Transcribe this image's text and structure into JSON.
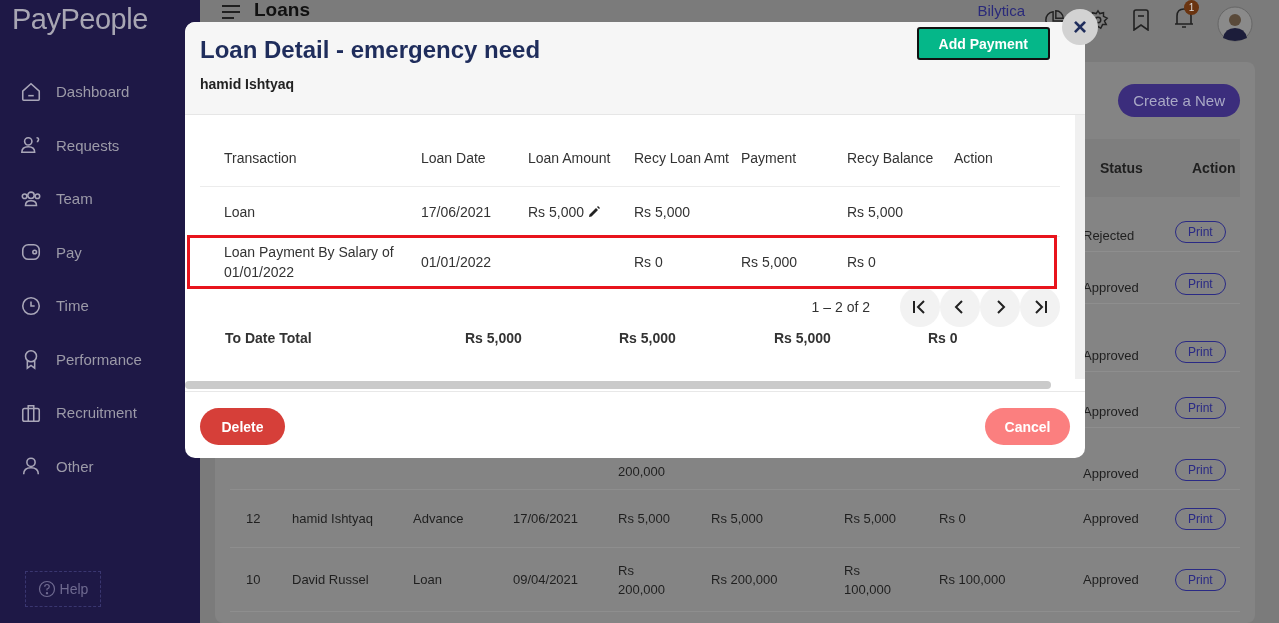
{
  "sidebar": {
    "logo": "PayPeople",
    "items": [
      {
        "label": "Dashboard"
      },
      {
        "label": "Requests"
      },
      {
        "label": "Team"
      },
      {
        "label": "Pay"
      },
      {
        "label": "Time"
      },
      {
        "label": "Performance"
      },
      {
        "label": "Recruitment"
      },
      {
        "label": "Other"
      }
    ],
    "help": "Help"
  },
  "header": {
    "title": "Loans",
    "company": "Bilytica",
    "notification_count": "1"
  },
  "page": {
    "create_button": "Create a New",
    "table": {
      "columns": [
        "Status",
        "Action"
      ],
      "rows": [
        {
          "status": "Rejected",
          "action": "Print"
        },
        {
          "status": "Approved",
          "action": "Print"
        },
        {
          "status": "Approved",
          "action": "Print"
        },
        {
          "status": "Approved",
          "action": "Print"
        },
        {
          "column_5": "200,000",
          "status": "Approved",
          "action": "Print"
        },
        {
          "column_1": "12",
          "column_2": "hamid Ishtyaq",
          "column_3": "Advance",
          "column_4": "17/06/2021",
          "column_5": "Rs 5,000",
          "column_6": "Rs 5,000",
          "column_7": "Rs 5,000",
          "column_8": "Rs 0",
          "status": "Approved",
          "action": "Print"
        },
        {
          "column_1": "10",
          "column_2": "David Russel",
          "column_3": "Loan",
          "column_4": "09/04/2021",
          "column_5": "Rs 200,000",
          "column_6": "Rs 200,000",
          "column_7": "Rs 100,000",
          "column_8": "Rs 100,000",
          "status": "Approved",
          "action": "Print"
        }
      ]
    }
  },
  "modal": {
    "title": "Loan Detail - emergency need",
    "subtitle": "hamid Ishtyaq",
    "add_button": "Add Payment",
    "close": "×",
    "table": {
      "columns": [
        "Transaction",
        "Loan Date",
        "Loan Amount",
        "Recy Loan Amt",
        "Payment",
        "Recy Balance",
        "Action"
      ],
      "rows": [
        {
          "transaction": "Loan",
          "loan_date": "17/06/2021",
          "loan_amount": "Rs 5,000",
          "editable": true,
          "recy_loan_amt": "Rs 5,000",
          "payment": "",
          "recy_balance": "Rs 5,000",
          "outlined": false
        },
        {
          "transaction": "Loan Payment By Salary of 01/01/2022",
          "loan_date": "01/01/2022",
          "loan_amount": "",
          "editable": false,
          "recy_loan_amt": "Rs 0",
          "payment": "Rs 5,000",
          "recy_balance": "Rs 0",
          "outlined": true
        }
      ],
      "pagination": "1 – 2 of 2",
      "totals": {
        "label": "To Date Total",
        "values": [
          "Rs 5,000",
          "Rs 5,000",
          "Rs 5,000",
          "Rs 0"
        ]
      }
    },
    "delete_button": "Delete",
    "cancel_button": "Cancel"
  }
}
